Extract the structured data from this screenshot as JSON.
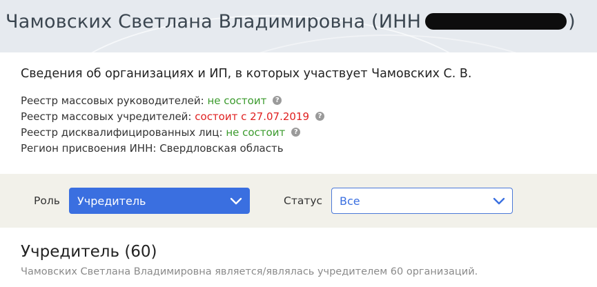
{
  "header": {
    "title_prefix": "Чамовских Светлана Владимировна (ИНН",
    "title_suffix": ")"
  },
  "info": {
    "subtitle": "Сведения об организациях и ИП, в которых участвует Чамовских С. В.",
    "rows": [
      {
        "label": "Реестр массовых руководителей:",
        "value": "не состоит",
        "status": "ok"
      },
      {
        "label": "Реестр массовых учредителей:",
        "value": "состоит с 27.07.2019",
        "status": "bad"
      },
      {
        "label": "Реестр дисквалифицированных лиц:",
        "value": "не состоит",
        "status": "ok"
      },
      {
        "label": "Регион присвоения ИНН:",
        "value": "Свердловская область"
      }
    ],
    "help_icon": "question-circle-icon"
  },
  "filters": {
    "role_label": "Роль",
    "role_value": "Учредитель",
    "status_label": "Статус",
    "status_value": "Все",
    "chevron_icon": "chevron-down-icon"
  },
  "section": {
    "title": "Учредитель (60)",
    "description": "Чамовских Светлана Владимировна является/являлась учредителем 60 организаций."
  },
  "colors": {
    "accent": "#3a6fe0",
    "ok": "#3a9a2c",
    "bad": "#e02020",
    "header_bg": "#e6eaef",
    "filter_bg": "#f2f1ea"
  }
}
